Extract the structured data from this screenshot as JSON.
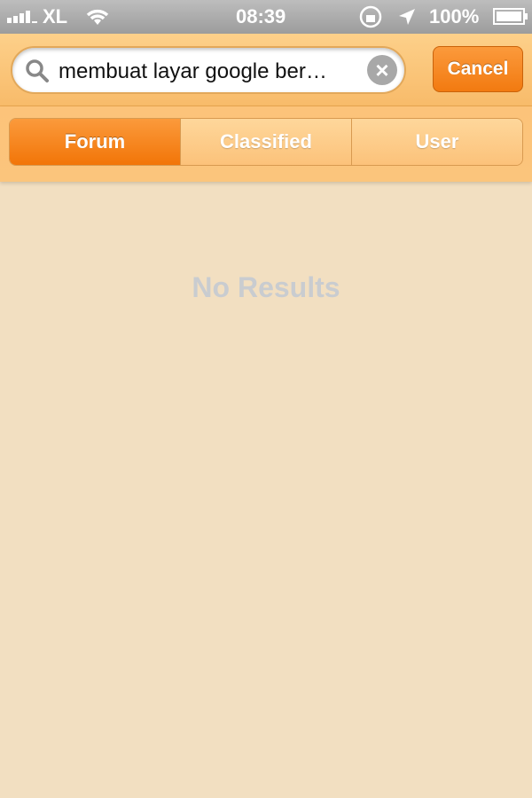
{
  "status_bar": {
    "carrier": "XL",
    "time": "08:39",
    "battery": "100%",
    "icons": [
      "signal-icon",
      "wifi-icon",
      "rotation-lock-icon",
      "location-icon",
      "battery-icon"
    ]
  },
  "search": {
    "value": "membuat layar google ber…",
    "cancel_label": "Cancel"
  },
  "segments": [
    {
      "label": "Forum",
      "selected": true
    },
    {
      "label": "Classified",
      "selected": false
    },
    {
      "label": "User",
      "selected": false
    }
  ],
  "empty_message": "No Results"
}
